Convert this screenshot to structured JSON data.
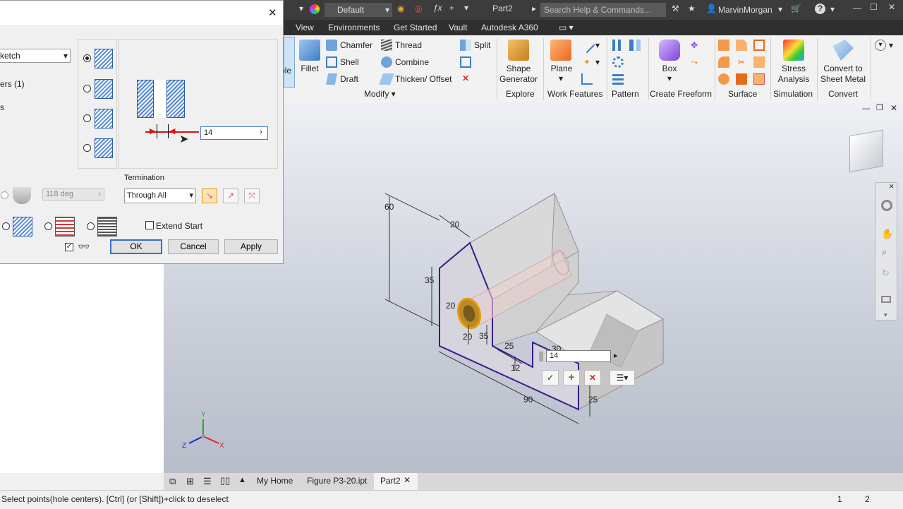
{
  "titlebar": {
    "appearance_value": "Default",
    "doc_name": "Part2",
    "search_placeholder": "Search Help & Commands...",
    "user": "MarvinMorgan"
  },
  "ribbon_tabs": [
    "View",
    "Environments",
    "Get Started",
    "Vault",
    "Autodesk A360"
  ],
  "ribbon": {
    "hole_partial": "ole",
    "fillet": "Fillet",
    "chamfer": "Chamfer",
    "shell": "Shell",
    "draft": "Draft",
    "thread": "Thread",
    "combine": "Combine",
    "thicken": "Thicken/ Offset",
    "split": "Split",
    "modify_panel": "Modify",
    "shape_generator": "Shape Generator",
    "explore_panel": "Explore",
    "plane": "Plane",
    "work_features_panel": "Work Features",
    "pattern_panel": "Pattern",
    "box": "Box",
    "create_freeform_panel": "Create Freeform",
    "surface_panel": "Surface",
    "stress_analysis": "Stress Analysis",
    "simulation_panel": "Simulation",
    "convert_sheet_metal": "Convert to Sheet Metal",
    "convert_panel": "Convert"
  },
  "dialog": {
    "placement_value": "ketch",
    "centers_label": "ers (1)",
    "third_label": "s",
    "depth_value": "14",
    "drill_angle": "118 deg",
    "termination_label": "Termination",
    "termination_value": "Through All",
    "extend_start": "Extend Start",
    "ok": "OK",
    "cancel": "Cancel",
    "apply": "Apply"
  },
  "viewport": {
    "dims": [
      "60",
      "20",
      "35",
      "20",
      "20",
      "35",
      "25",
      "12",
      "30",
      "90",
      "25"
    ],
    "mini_toolbar_value": "14"
  },
  "doc_tabs": [
    "My Home",
    "Figure P3-20.ipt",
    "Part2"
  ],
  "status": {
    "text": "Select points(hole centers). [Ctrl] (or [Shift])+click to deselect",
    "num1": "1",
    "num2": "2"
  },
  "colors": {
    "accent_blue": "#2b5da8",
    "profile_purple": "#3a1a8a",
    "hole_orange": "#d48a00",
    "title_bg": "#3c3c3c"
  }
}
